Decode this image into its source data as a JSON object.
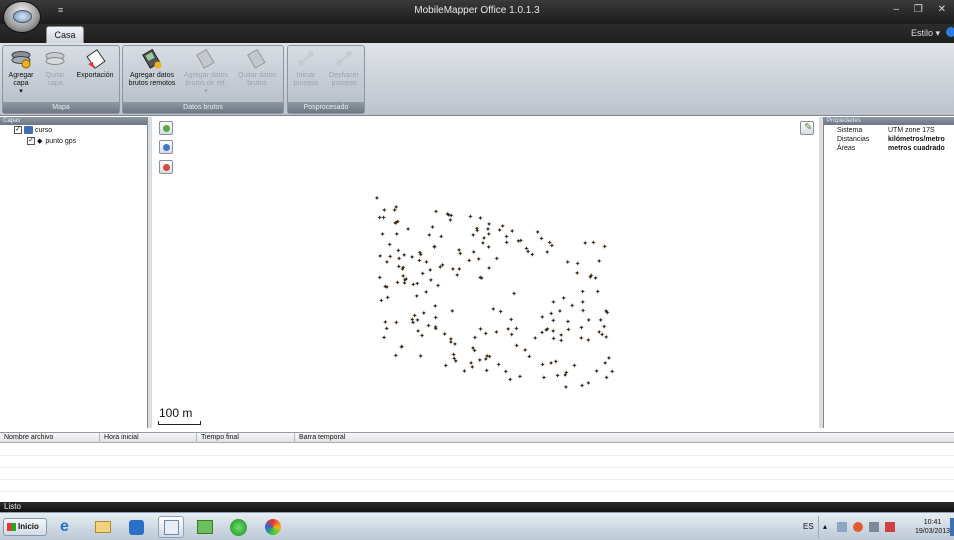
{
  "window": {
    "title": "MobileMapper Office 1.0.1.3",
    "quick_access": "≡",
    "controls": "– ❐ ✕"
  },
  "tabs": {
    "active": "Casa",
    "style_menu": "Estilo ▾"
  },
  "ribbon": {
    "groups": [
      {
        "label": "Mapa",
        "buttons": [
          "Agregar capa",
          "Quitar capa",
          "Exportación"
        ]
      },
      {
        "label": "Datos brutos",
        "buttons": [
          "Agregar datos brutos remotos",
          "Agregar datos brutos de ref.",
          "Quitar datos brutos"
        ]
      },
      {
        "label": "Posprocesado",
        "buttons": [
          "Iniciar proceso",
          "Deshacer proceso"
        ]
      }
    ],
    "mapa_b1_l1": "Agregar",
    "mapa_b1_l2": "capa",
    "mapa_b2_l1": "Quitar",
    "mapa_b2_l2": "capa",
    "mapa_b3_l1": "Exportación",
    "db_b1_l1": "Agregar datos",
    "db_b1_l2": "brutos remotos",
    "db_b2_l1": "Agregar datos",
    "db_b2_l2": "brutos de ref.",
    "db_b3_l1": "Quitar datos",
    "db_b3_l2": "brutos",
    "pp_b1_l1": "Iniciar",
    "pp_b1_l2": "proceso",
    "pp_b2_l1": "Deshacer",
    "pp_b2_l2": "proceso",
    "group_mapa": "Mapa",
    "group_datos": "Datos brutos",
    "group_pos": "Posprocesado"
  },
  "layers": {
    "header": "Capas",
    "root": {
      "label": "curso",
      "checked": true
    },
    "child": {
      "label": "punto gps",
      "checked": true
    }
  },
  "map": {
    "scale_label": "100 m",
    "point_color": "#3b2a1a"
  },
  "properties": {
    "header": "Propiedades",
    "rows": [
      {
        "key": "Sistema",
        "value": "UTM zone 17S"
      },
      {
        "key": "Distancias",
        "value": "kilómetros/metro"
      },
      {
        "key": "Áreas",
        "value": "metros cuadrado"
      }
    ]
  },
  "table": {
    "columns": [
      "Nombre archivo",
      "Hora inicial",
      "Tiempo final",
      "Barra temporal"
    ]
  },
  "status": {
    "text": "Listo"
  },
  "taskbar": {
    "start_label": "Inicio",
    "language": "ES",
    "time": "10:41",
    "date": "19/03/2013"
  }
}
